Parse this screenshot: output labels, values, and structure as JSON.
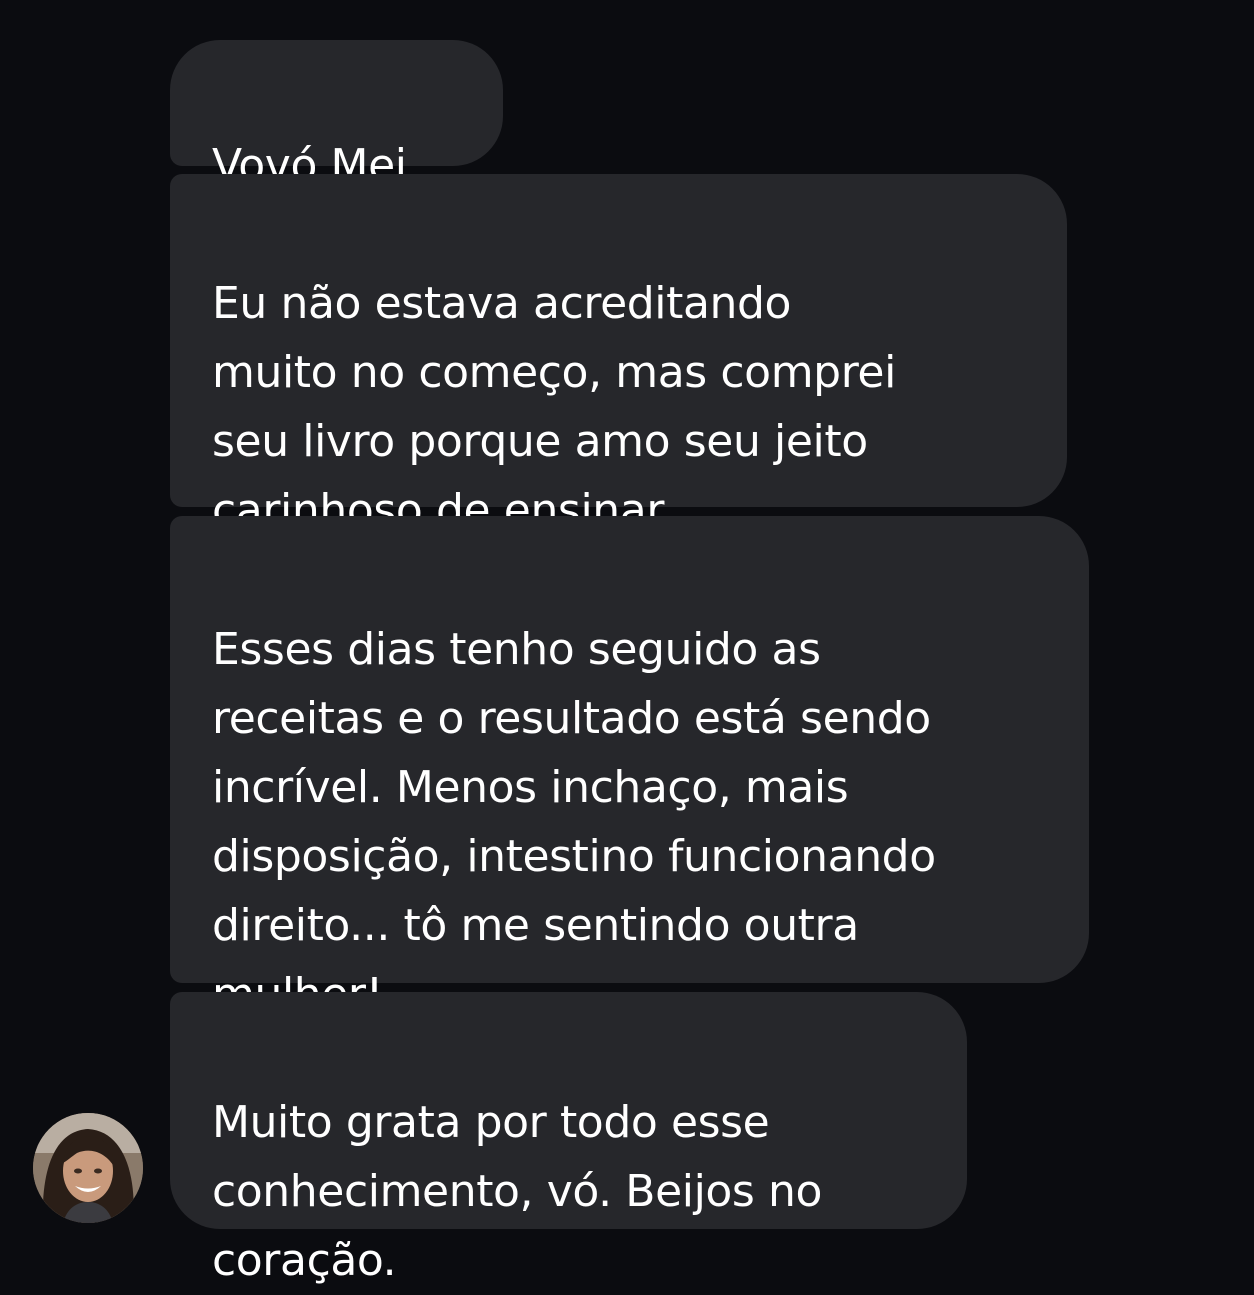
{
  "chat": {
    "messages": [
      {
        "text": "Vovó Mei."
      },
      {
        "text": "Eu não estava acreditando\nmuito no começo, mas comprei\nseu livro porque amo seu jeito\ncarinhoso de ensinar."
      },
      {
        "text": "Esses dias tenho seguido as\nreceitas e o resultado está sendo\nincrível. Menos inchaço, mais\ndisposição, intestino funcionando\ndireito... tô me sentindo outra\nmulher!"
      },
      {
        "text": "Muito grata por todo esse\nconhecimento, vó. Beijos no\ncoração."
      }
    ]
  },
  "theme": {
    "background": "#0b0c10",
    "bubble": "#26272b",
    "text": "#ffffff"
  }
}
